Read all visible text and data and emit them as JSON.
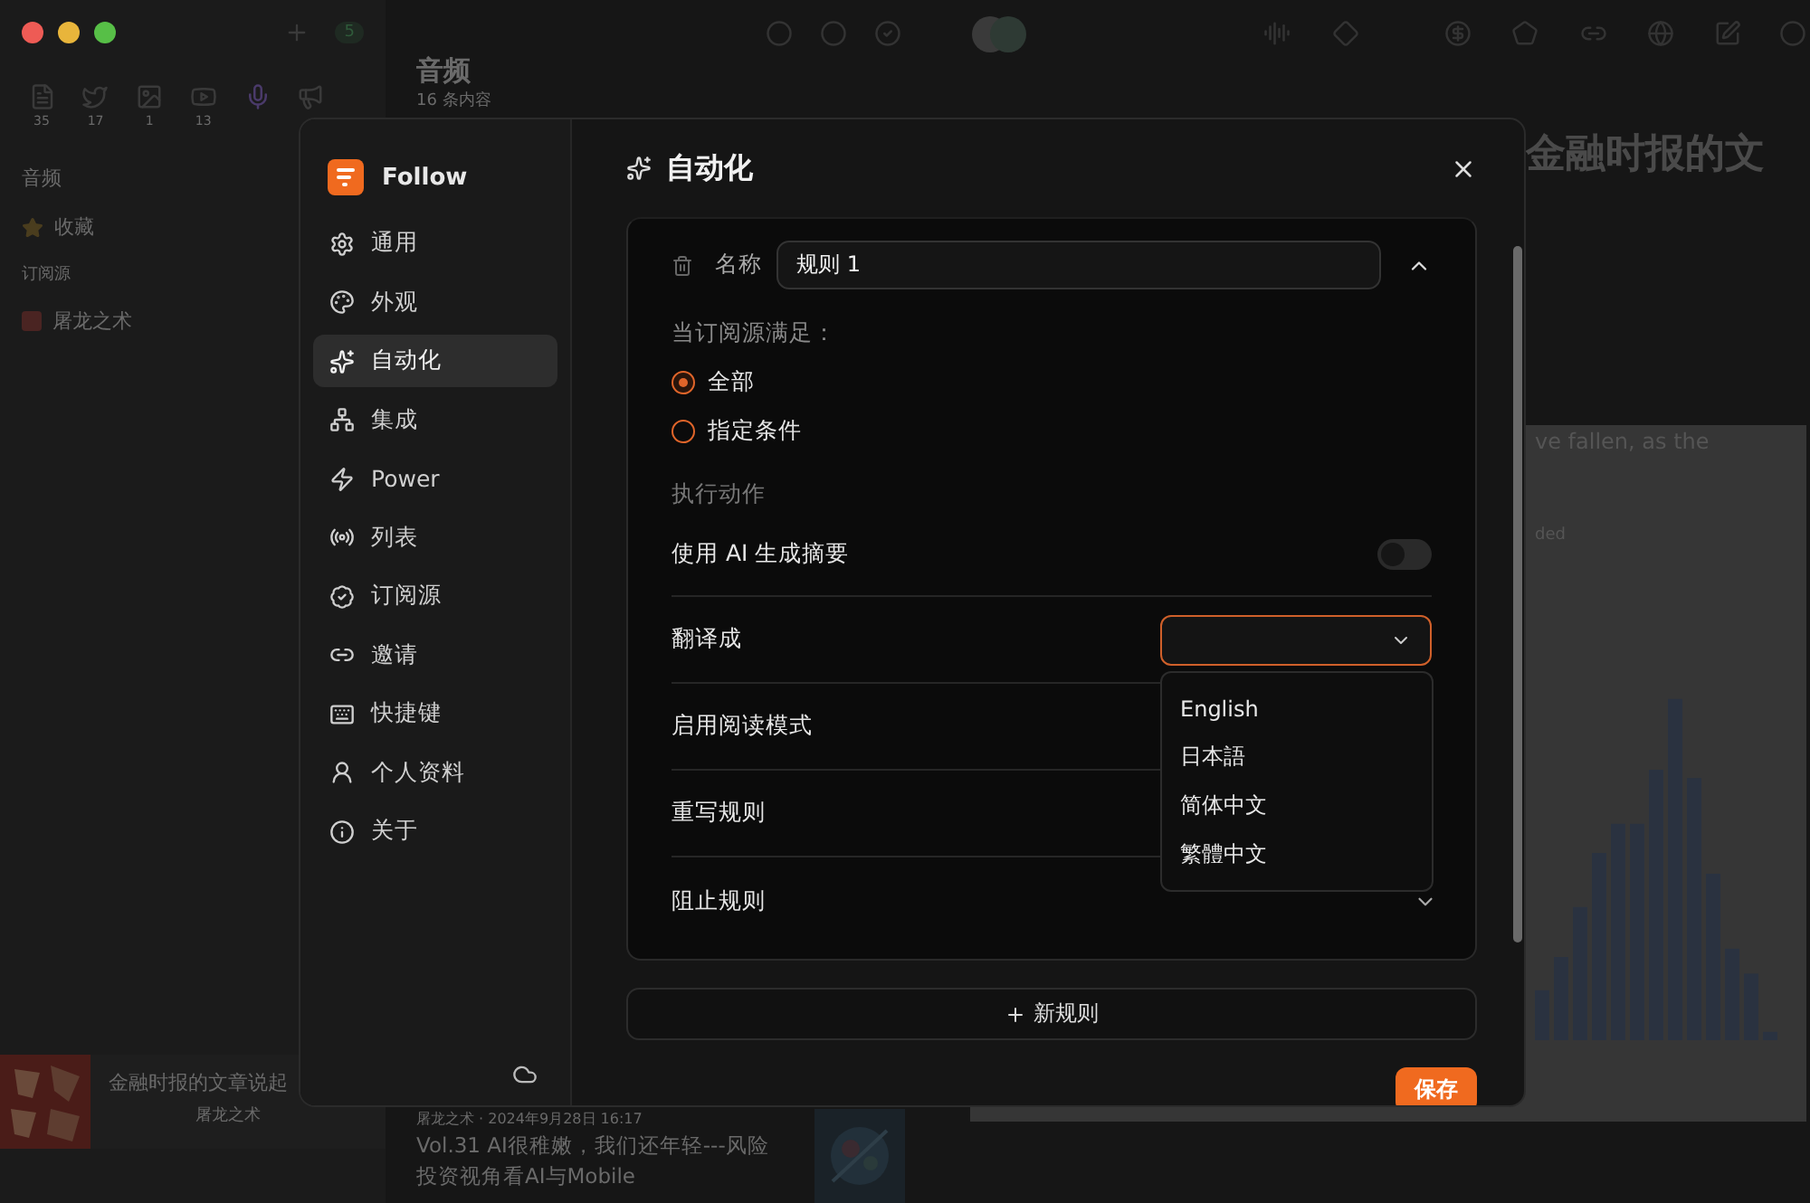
{
  "background": {
    "new_badge": "5",
    "views": [
      {
        "count": "35",
        "selected": false
      },
      {
        "count": "17",
        "selected": false
      },
      {
        "count": "1",
        "selected": false
      },
      {
        "count": "13",
        "selected": false
      },
      {
        "selected": true
      },
      {
        "selected": false
      }
    ],
    "sidebar": {
      "title": "音频",
      "starred": "收藏",
      "section": "订阅源",
      "feeds": [
        {
          "label": "屠龙之术"
        }
      ]
    },
    "list": {
      "title": "音频",
      "count": "16 条内容"
    },
    "entries": [
      {
        "title": "金融时报的文章说起",
        "source": "屠龙之术"
      }
    ],
    "entry_bottom": {
      "meta": "屠龙之术 · 2024年9月28日 16:17",
      "title_line_1": "Vol.31 AI很稚嫩，我们还年轻---风险",
      "title_line_2": "投资视角看AI与Mobile"
    },
    "article": {
      "headline": "金融时报的文",
      "text_1": "ve fallen, as the",
      "text_2": "ded"
    }
  },
  "dialog": {
    "app_name": "Follow",
    "nav": [
      {
        "label": "通用",
        "selected": false
      },
      {
        "label": "外观",
        "selected": false
      },
      {
        "label": "自动化",
        "selected": true
      },
      {
        "label": "集成",
        "selected": false
      },
      {
        "label": "Power",
        "selected": false
      },
      {
        "label": "列表",
        "selected": false
      },
      {
        "label": "订阅源",
        "selected": false
      },
      {
        "label": "邀请",
        "selected": false
      },
      {
        "label": "快捷键",
        "selected": false
      },
      {
        "label": "个人资料",
        "selected": false
      },
      {
        "label": "关于",
        "selected": false
      }
    ],
    "title": "自动化",
    "rule": {
      "expanded": true,
      "name_label": "名称",
      "name_value": "规则 1",
      "condition_label": "当订阅源满足：",
      "match_options": [
        {
          "label": "全部",
          "selected": true
        },
        {
          "label": "指定条件",
          "selected": false
        }
      ],
      "actions_label": "执行动作",
      "actions": [
        {
          "kind": "toggle",
          "label": "使用 AI 生成摘要",
          "on": false
        },
        {
          "kind": "select",
          "label": "翻译成",
          "expanded": true,
          "options": [
            "English",
            "日本語",
            "简体中文",
            "繁體中文"
          ]
        },
        {
          "kind": "row",
          "label": "启用阅读模式"
        },
        {
          "kind": "row",
          "label": "重写规则"
        },
        {
          "kind": "collapsible",
          "label": "阻止规则",
          "expanded": false
        }
      ]
    },
    "add_button": "新规则",
    "save_button": "保存"
  }
}
